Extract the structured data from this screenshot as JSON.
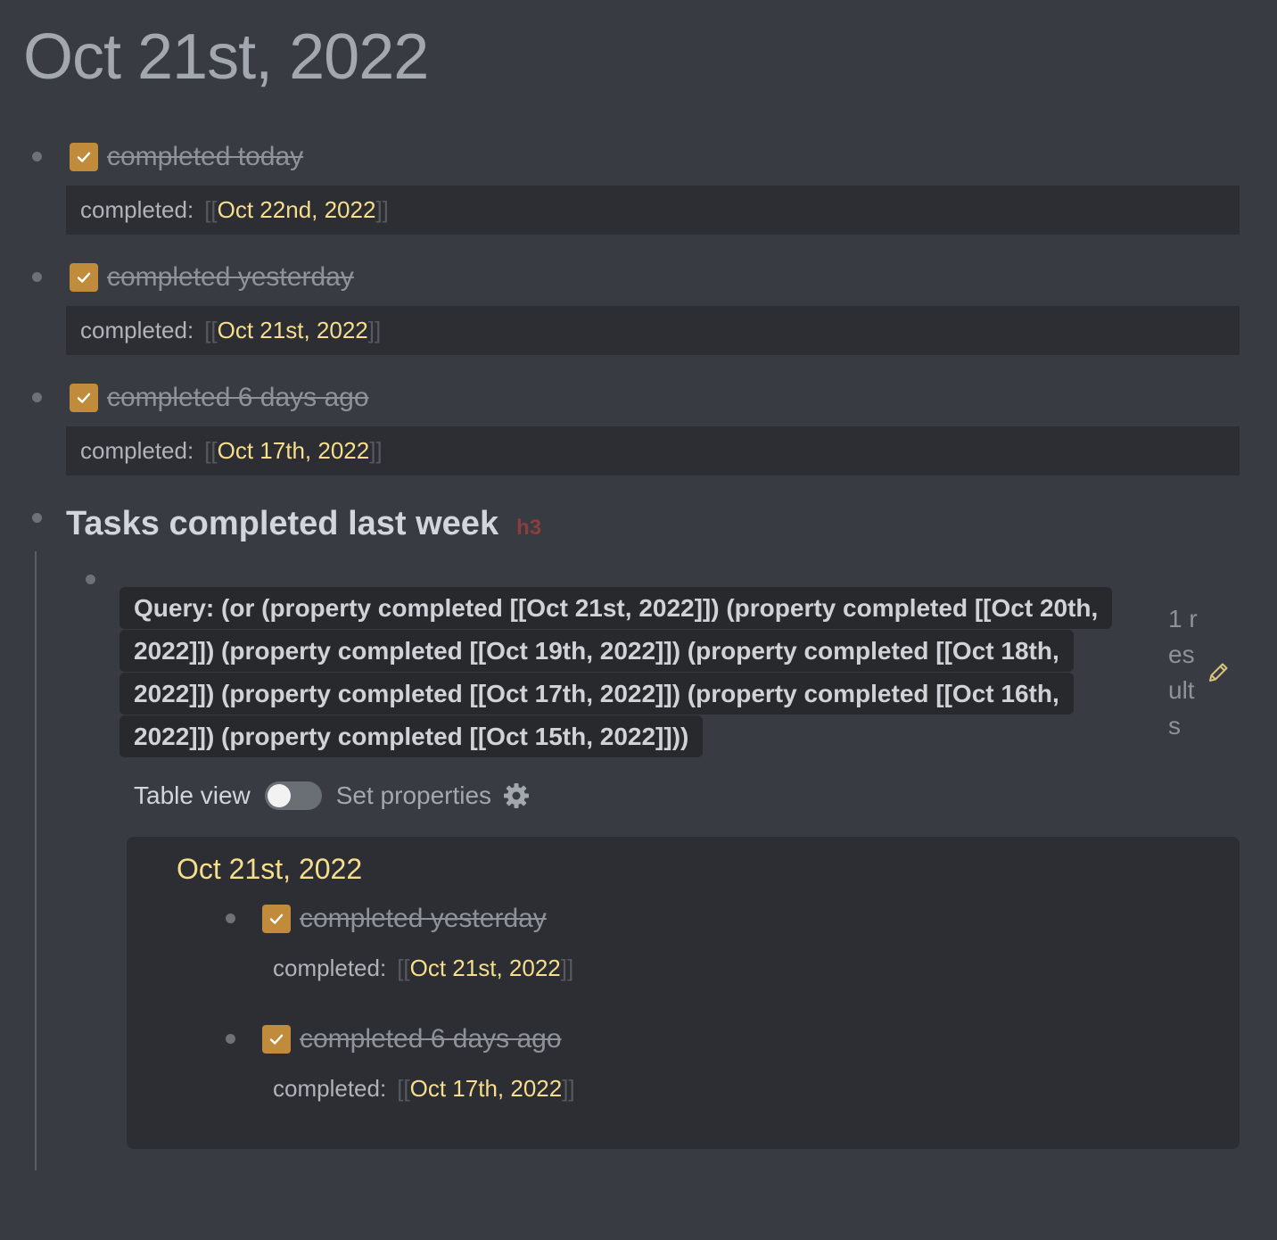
{
  "page": {
    "title": "Oct 21st, 2022"
  },
  "colors": {
    "background": "#383b41",
    "block_background": "#2c2e33",
    "checkbox": "#c18b3c",
    "link": "#f6de8c",
    "heading_badge": "#8a3f3f"
  },
  "tasks": [
    {
      "label": "completed today",
      "checked": true,
      "property_key": "completed:",
      "property_value": "Oct 22nd, 2022"
    },
    {
      "label": "completed yesterday",
      "checked": true,
      "property_key": "completed:",
      "property_value": "Oct 21st, 2022"
    },
    {
      "label": "completed 6 days ago",
      "checked": true,
      "property_key": "completed:",
      "property_value": "Oct 17th, 2022"
    }
  ],
  "brackets": {
    "open": "[[",
    "close": "]]"
  },
  "section": {
    "heading": "Tasks completed last week",
    "heading_level": "h3"
  },
  "query": {
    "text": "Query: (or (property completed [[Oct 21st, 2022]]) (property completed [[Oct 20th, 2022]]) (property completed [[Oct 19th, 2022]]) (property completed [[Oct 18th, 2022]]) (property completed [[Oct 17th, 2022]]) (property completed [[Oct 16th, 2022]]) (property completed [[Oct 15th, 2022]]))",
    "results_count": "1 results",
    "edit_icon": "pencil-icon"
  },
  "toolbar": {
    "table_view_label": "Table view",
    "table_view_on": false,
    "set_properties_label": "Set properties",
    "settings_icon": "gear-icon"
  },
  "results": {
    "group_title": "Oct 21st, 2022",
    "items": [
      {
        "label": "completed yesterday",
        "checked": true,
        "property_key": "completed:",
        "property_value": "Oct 21st, 2022"
      },
      {
        "label": "completed 6 days ago",
        "checked": true,
        "property_key": "completed:",
        "property_value": "Oct 17th, 2022"
      }
    ]
  }
}
